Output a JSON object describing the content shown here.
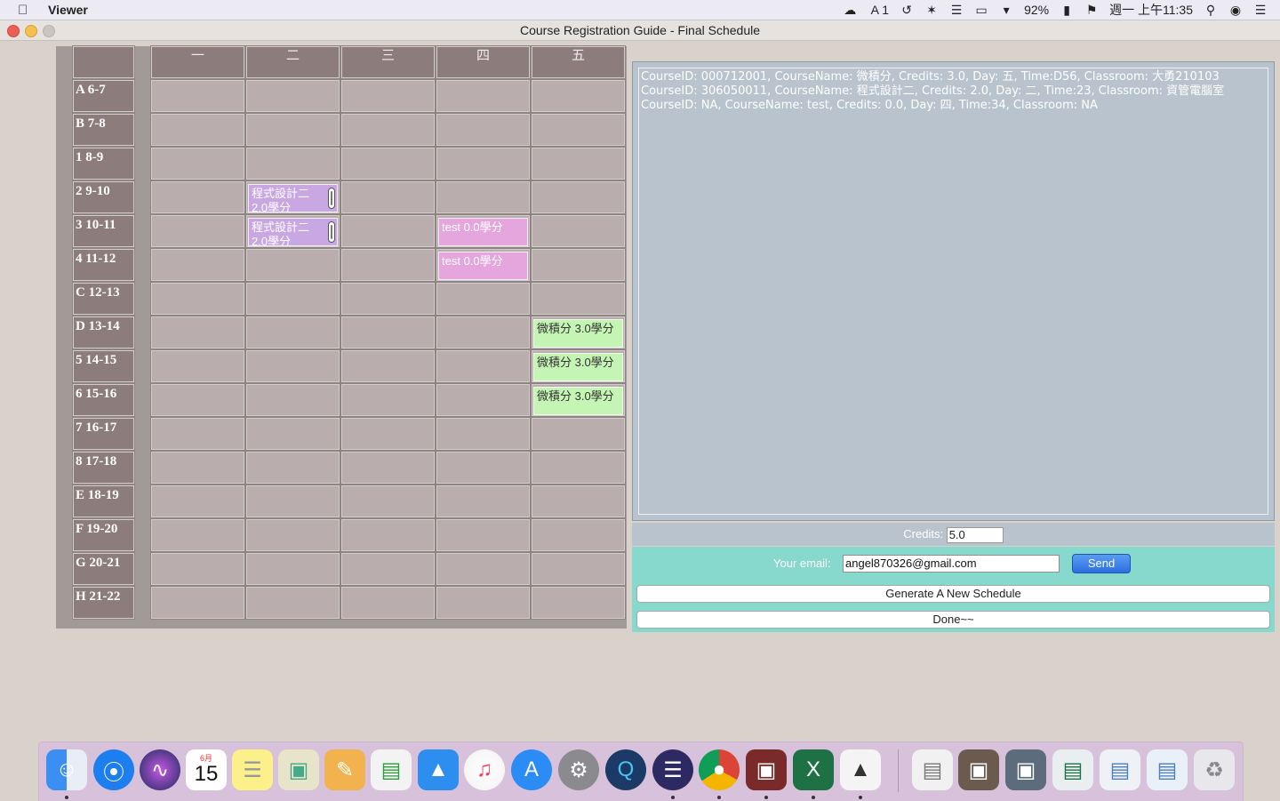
{
  "menubar": {
    "app_name": "Viewer",
    "battery_percent": "92%",
    "keyboard_indicator": "1",
    "clock": "週一 上午11:35"
  },
  "window": {
    "title": "Course Registration Guide - Final Schedule"
  },
  "schedule": {
    "day_headers": [
      "一",
      "二",
      "三",
      "四",
      "五"
    ],
    "period_labels": [
      "A 6-7",
      "B 7-8",
      "1 8-9",
      "2 9-10",
      "3 10-11",
      "4 11-12",
      "C 12-13",
      "D 13-14",
      "5 14-15",
      "6 15-16",
      "7 16-17",
      "8 17-18",
      "E 18-19",
      "F 19-20",
      "G 20-21",
      "H 21-22"
    ],
    "courses": {
      "prog2_a": "程式設計二 2.0學分",
      "prog2_b": "程式設計二 2.0學分",
      "test_a": "test 0.0學分",
      "test_b": "test 0.0學分",
      "calc_a": "微積分 3.0學分",
      "calc_b": "微積分 3.0學分",
      "calc_c": "微積分 3.0學分"
    }
  },
  "log": {
    "lines": [
      "CourseID: 000712001, CourseName: 微積分, Credits: 3.0, Day: 五, Time:D56, Classroom: 大勇210103",
      "CourseID: 306050011, CourseName: 程式設計二, Credits: 2.0, Day: 二, Time:23, Classroom: 資管電腦室",
      "CourseID: NA, CourseName: test, Credits: 0.0, Day: 四, Time:34, Classroom: NA"
    ]
  },
  "credits": {
    "label": "Credits:",
    "value": "5.0"
  },
  "email": {
    "label": "Your email:",
    "value": "angel870326@gmail.com",
    "send_label": "Send"
  },
  "buttons": {
    "generate_label": "Generate A New Schedule",
    "done_label": "Done~~"
  },
  "dock": {
    "calendar_month": "6月",
    "calendar_day": "15"
  }
}
